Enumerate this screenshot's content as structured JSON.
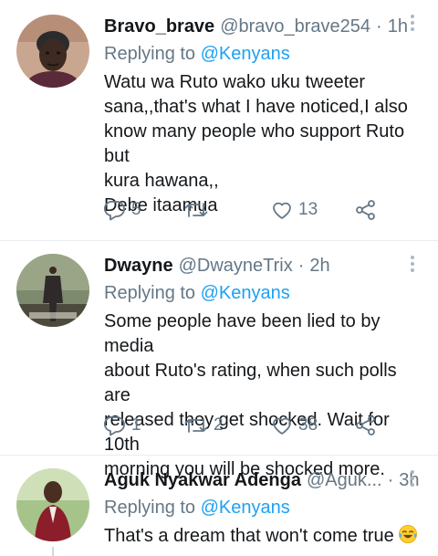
{
  "tweets": [
    {
      "name": "Bravo_brave",
      "handle": "@bravo_brave254",
      "time": "1h",
      "replying_prefix": "Replying to",
      "replying_to": "@Kenyans",
      "lines": [
        "Watu wa Ruto wako uku tweeter",
        "sana,,that's what I have noticed,I also",
        "know many people who support Ruto but",
        "kura hawana,,",
        "Debe itaamua"
      ],
      "replies": "5",
      "retweets": "",
      "likes": "13"
    },
    {
      "name": "Dwayne",
      "handle": "@DwayneTrix",
      "time": "2h",
      "replying_prefix": "Replying to",
      "replying_to": "@Kenyans",
      "lines": [
        "Some people have been lied to by media",
        "about Ruto's rating, when such polls are",
        "released they get shocked. Wait for 10th",
        "morning you will be shocked more."
      ],
      "replies": "1",
      "retweets": "2",
      "likes": "38"
    },
    {
      "name": "Aguk Nyakwar Adenga",
      "handle": "@Aguk...",
      "time": "3h",
      "replying_prefix": "Replying to",
      "replying_to": "@Kenyans",
      "lines": [
        "That's a dream that won't come true"
      ],
      "emoji": "face-with-tears-of-joy"
    }
  ],
  "icons": {
    "reply": "reply-icon",
    "retweet": "retweet-icon",
    "like": "heart-icon",
    "share": "share-icon",
    "more": "more-vertical-icon"
  },
  "colors": {
    "text": "#14171a",
    "secondary": "#657786",
    "link": "#1da1f2",
    "divider": "#e6ecf0"
  }
}
